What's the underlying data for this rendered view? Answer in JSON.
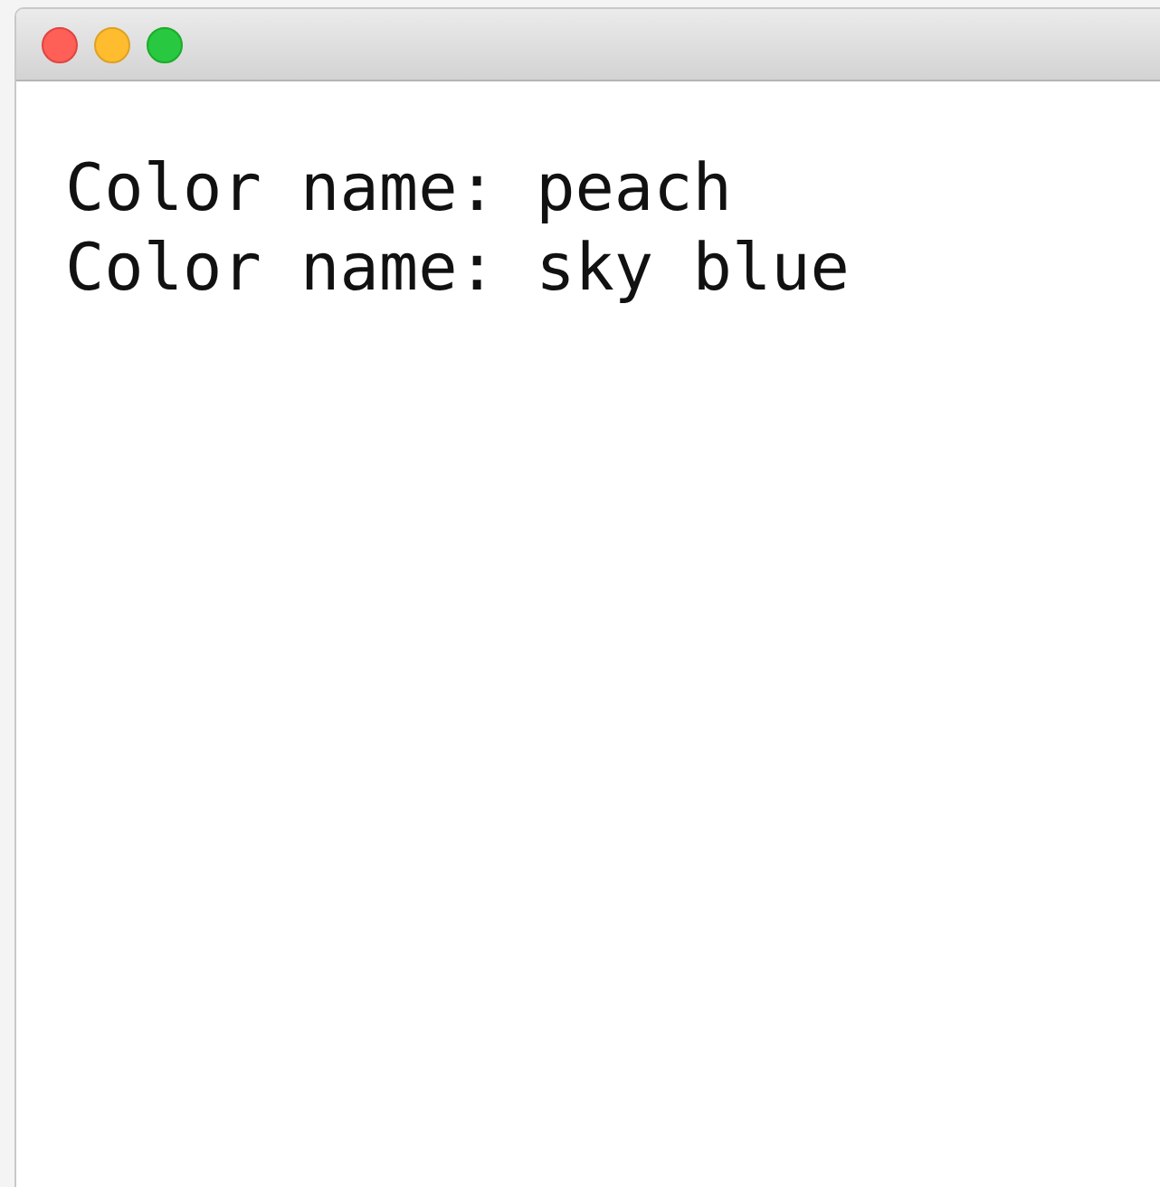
{
  "window": {
    "controls": [
      {
        "kind": "close"
      },
      {
        "kind": "minimize"
      },
      {
        "kind": "zoom"
      }
    ]
  },
  "lines": [
    "Color name: peach",
    "Color name: sky blue"
  ]
}
